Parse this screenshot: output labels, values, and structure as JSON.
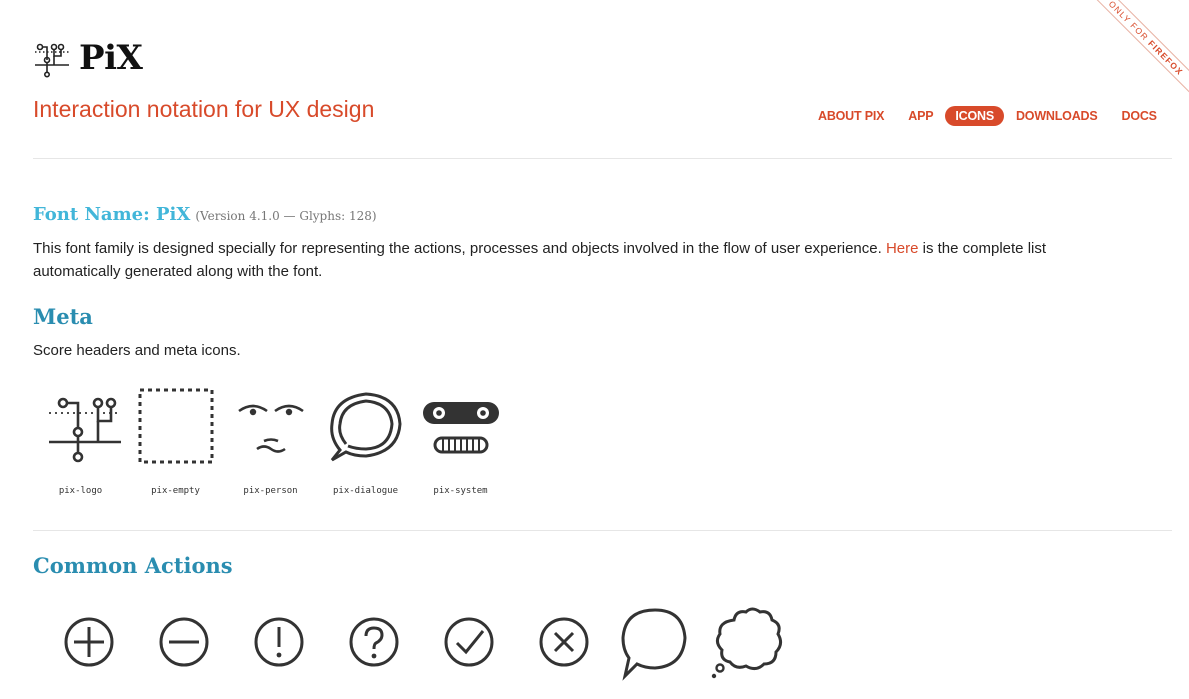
{
  "ribbon": {
    "prefix": "ONLY FOR ",
    "strong": "FIREFOX"
  },
  "brand": {
    "name": "PiX",
    "tagline": "Interaction notation for UX design"
  },
  "nav": [
    {
      "label": "ABOUT PIX",
      "active": false
    },
    {
      "label": "APP",
      "active": false
    },
    {
      "label": "ICONS",
      "active": true
    },
    {
      "label": "DOWNLOADS",
      "active": false
    },
    {
      "label": "DOCS",
      "active": false
    }
  ],
  "font": {
    "title": "Font Name: PiX",
    "version": "(Version 4.1.0 — Glyphs: 128)",
    "desc_before": "This font family is designed specially for representing the actions, processes and objects involved in the flow of user experience. ",
    "desc_link": "Here",
    "desc_after": " is the complete list automatically generated along with the font."
  },
  "meta": {
    "title": "Meta",
    "subtitle": "Score headers and meta icons.",
    "icons": [
      {
        "label": "pix-logo",
        "icon": "logo-icon"
      },
      {
        "label": "pix-empty",
        "icon": "empty-icon"
      },
      {
        "label": "pix-person",
        "icon": "person-icon"
      },
      {
        "label": "pix-dialogue",
        "icon": "dialogue-icon"
      },
      {
        "label": "pix-system",
        "icon": "system-icon"
      }
    ]
  },
  "common_actions": {
    "title": "Common Actions",
    "icons": [
      "add-icon",
      "remove-icon",
      "alert-icon",
      "question-icon",
      "check-icon",
      "close-icon",
      "speech-bubble-icon",
      "thought-bubble-icon"
    ]
  },
  "colors": {
    "accent": "#d84a2a",
    "heading": "#2a8db0",
    "font_title": "#42b6d9",
    "icon": "#333333"
  }
}
